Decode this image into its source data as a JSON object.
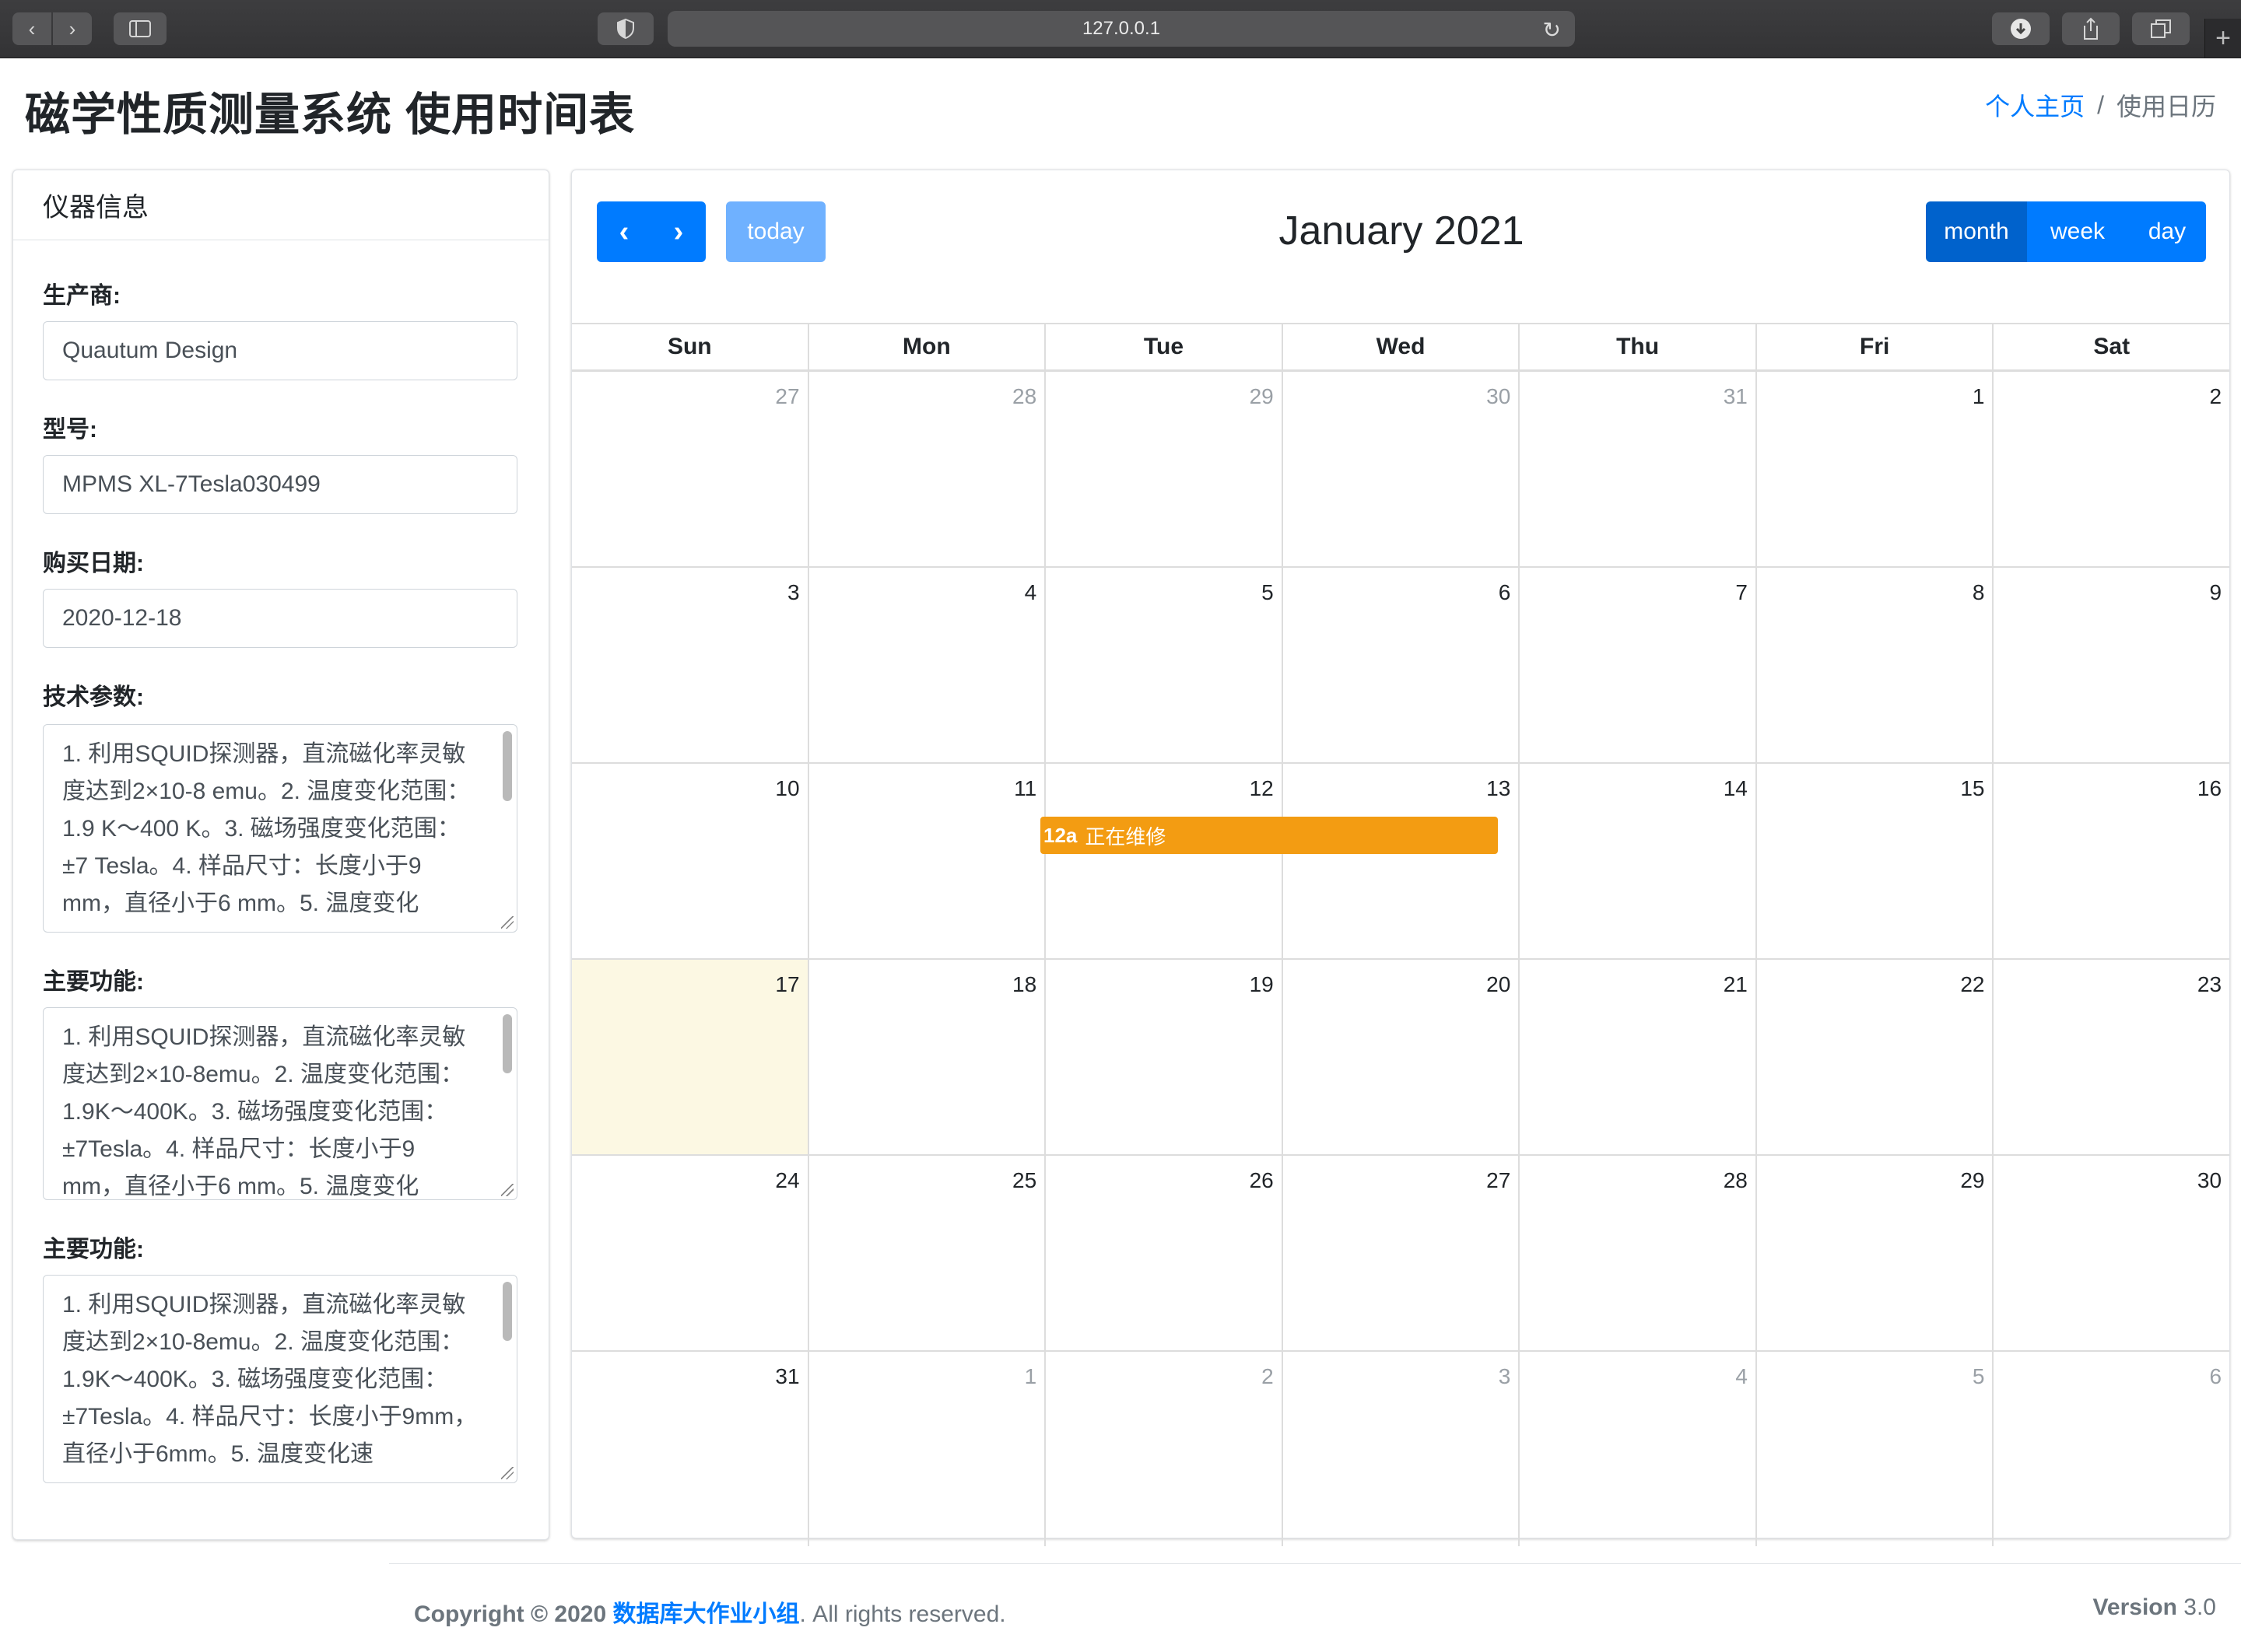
{
  "browser": {
    "back_icon": "chevron-left-icon",
    "forward_icon": "chevron-right-icon",
    "address": "127.0.0.1"
  },
  "header": {
    "title": "磁学性质测量系统 使用时间表",
    "breadcrumb_home": "个人主页",
    "breadcrumb_sep": "/",
    "breadcrumb_current": "使用日历"
  },
  "instrument": {
    "card_title": "仪器信息",
    "manufacturer_label": "生产商:",
    "manufacturer_value": "Quautum Design",
    "model_label": "型号:",
    "model_value": "MPMS XL-7Tesla030499",
    "purchase_label": "购买日期:",
    "purchase_value": "2020-12-18",
    "tech_label": "技术参数:",
    "tech_value": "1. 利用SQUID探测器，直流磁化率灵敏度达到2×10-8 emu。2. 温度变化范围：1.9 K～400 K。3. 磁场强度变化范围：±7 Tesla。4. 样品尺寸：长度小于9 mm，直径小于6 mm。5. 温度变化",
    "func1_label": "主要功能:",
    "func1_value": "1. 利用SQUID探测器，直流磁化率灵敏度达到2×10-8emu。2. 温度变化范围：1.9K～400K。3. 磁场强度变化范围：±7Tesla。4. 样品尺寸：长度小于9 mm，直径小于6 mm。5. 温度变化",
    "func2_label": "主要功能:",
    "func2_value": "1. 利用SQUID探测器，直流磁化率灵敏度达到2×10-8emu。2. 温度变化范围：1.9K～400K。3. 磁场强度变化范围：±7Tesla。4. 样品尺寸：长度小于9mm，直径小于6mm。5. 温度变化速"
  },
  "calendar": {
    "title": "January 2021",
    "today_label": "today",
    "views": {
      "month": "month",
      "week": "week",
      "day": "day"
    },
    "days_of_week": [
      "Sun",
      "Mon",
      "Tue",
      "Wed",
      "Thu",
      "Fri",
      "Sat"
    ],
    "weeks": [
      [
        "27",
        "28",
        "29",
        "30",
        "31",
        "1",
        "2"
      ],
      [
        "3",
        "4",
        "5",
        "6",
        "7",
        "8",
        "9"
      ],
      [
        "10",
        "11",
        "12",
        "13",
        "14",
        "15",
        "16"
      ],
      [
        "17",
        "18",
        "19",
        "20",
        "21",
        "22",
        "23"
      ],
      [
        "24",
        "25",
        "26",
        "27",
        "28",
        "29",
        "30"
      ],
      [
        "31",
        "1",
        "2",
        "3",
        "4",
        "5",
        "6"
      ]
    ],
    "event": {
      "time": "12a",
      "title": "正在维修",
      "color": "#f39c12"
    }
  },
  "footer": {
    "copyright_prefix": "Copyright © 2020",
    "brand": "数据库大作业小组",
    "rights": ". All rights reserved.",
    "version_label": "Version",
    "version_value": "3.0"
  },
  "colors": {
    "primary": "#007bff",
    "primary_active": "#0062cc",
    "today_bg": "#fcf8e3"
  }
}
